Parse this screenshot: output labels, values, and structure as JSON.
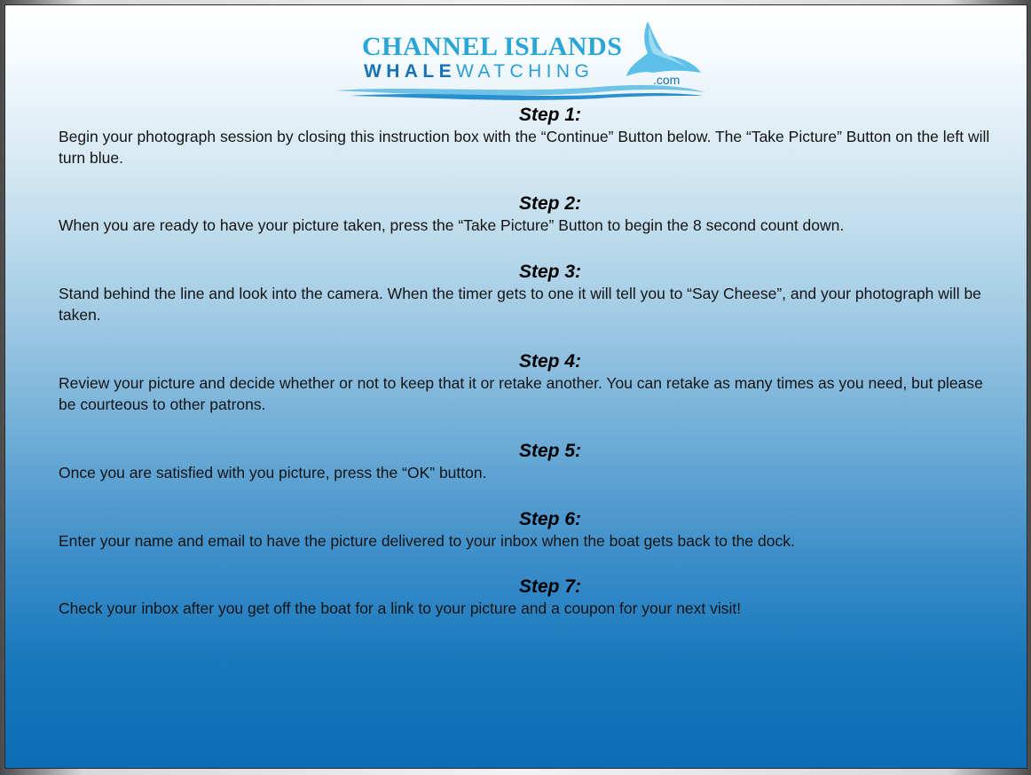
{
  "logo": {
    "line1": "CHANNEL ISLANDS",
    "line2_bold": "WHALE",
    "line2_regular": "WATCHING",
    "suffix": ".com",
    "icon": "whale-tail-icon"
  },
  "colors": {
    "logo_light_blue": "#2aa6d6",
    "logo_dark_blue": "#1673b8",
    "panel_bottom": "#0a6db5"
  },
  "steps": [
    {
      "title": "Step 1:",
      "body": "Begin your photograph session by closing this instruction box with the “Continue” Button below. The “Take Picture” Button on the left will turn blue."
    },
    {
      "title": "Step 2:",
      "body": "When you are ready to have your picture taken, press the “Take Picture” Button to begin the 8 second count down."
    },
    {
      "title": "Step 3:",
      "body": "Stand behind the line and look into the camera. When the timer gets to one it will tell you to “Say Cheese”, and your photograph will be taken."
    },
    {
      "title": "Step 4:",
      "body": "Review your picture and decide whether or not to keep that it or retake another. You can retake as many times as you need, but please be courteous to other patrons."
    },
    {
      "title": "Step 5:",
      "body": "Once you are satisfied with you picture, press the “OK” button."
    },
    {
      "title": "Step 6:",
      "body": "Enter your name and email to have the picture delivered to your inbox when the boat gets back to the dock."
    },
    {
      "title": "Step 7:",
      "body": "Check your inbox after you get off the boat for a link to your  picture and a coupon for your next visit!"
    }
  ]
}
